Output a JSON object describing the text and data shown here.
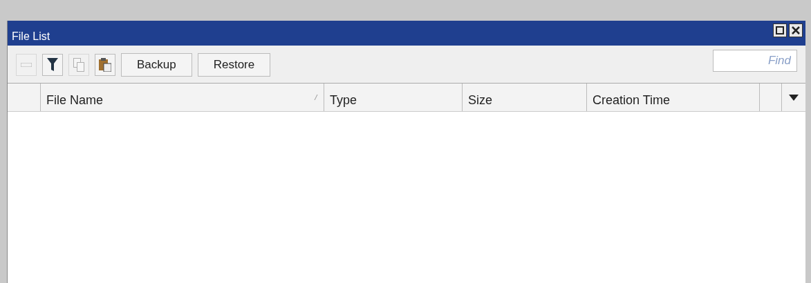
{
  "window": {
    "title": "File List"
  },
  "toolbar": {
    "tools": [
      {
        "kind": "remove",
        "disabled": true
      },
      {
        "kind": "filter",
        "disabled": false
      },
      {
        "kind": "copy",
        "disabled": true
      },
      {
        "kind": "paste",
        "disabled": false
      }
    ],
    "buttons": [
      "Backup",
      "Restore"
    ],
    "search": {
      "placeholder": "Find"
    }
  },
  "table": {
    "columns": [
      {
        "label": "File Name",
        "sorted": true
      },
      {
        "label": "Type",
        "sorted": false
      },
      {
        "label": "Size",
        "sorted": false
      },
      {
        "label": "Creation Time",
        "sorted": false
      }
    ]
  }
}
